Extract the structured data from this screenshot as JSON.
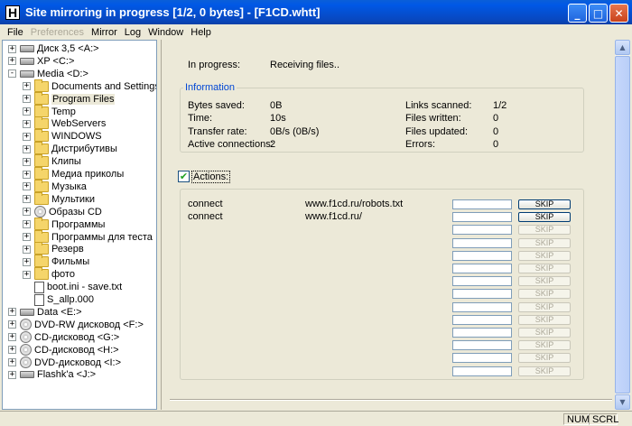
{
  "window": {
    "title": "Site mirroring in progress [1/2, 0 bytes] - [F1CD.whtt]",
    "icon_letter": "H",
    "buttons": [
      "minimize-icon",
      "maximize-icon",
      "close-icon"
    ]
  },
  "menu": [
    "File",
    "Preferences",
    "Mirror",
    "Log",
    "Window",
    "Help"
  ],
  "tree": [
    {
      "label": "Диск 3,5 <A:>",
      "icon": "floppy-drive-icon",
      "expander": "+",
      "level": 0
    },
    {
      "label": "XP <C:>",
      "icon": "hard-drive-icon",
      "expander": "+",
      "level": 0
    },
    {
      "label": "Media <D:>",
      "icon": "hard-drive-icon",
      "expander": "-",
      "level": 0
    },
    {
      "label": "Documents and Settings",
      "icon": "folder-icon",
      "expander": "+",
      "level": 1
    },
    {
      "label": "Program Files",
      "icon": "folder-icon",
      "expander": "+",
      "level": 1,
      "selected": true
    },
    {
      "label": "Temp",
      "icon": "folder-icon",
      "expander": "+",
      "level": 1
    },
    {
      "label": "WebServers",
      "icon": "folder-icon",
      "expander": "+",
      "level": 1
    },
    {
      "label": "WINDOWS",
      "icon": "folder-icon",
      "expander": "+",
      "level": 1
    },
    {
      "label": "Дистрибутивы",
      "icon": "folder-icon",
      "expander": "+",
      "level": 1
    },
    {
      "label": "Клипы",
      "icon": "folder-icon",
      "expander": "+",
      "level": 1
    },
    {
      "label": "Медиа приколы",
      "icon": "folder-icon",
      "expander": "+",
      "level": 1
    },
    {
      "label": "Музыка",
      "icon": "music-folder-icon",
      "expander": "+",
      "level": 1
    },
    {
      "label": "Мультики",
      "icon": "folder-icon",
      "expander": "+",
      "level": 1
    },
    {
      "label": "Образы CD",
      "icon": "cd-folder-icon",
      "expander": "+",
      "level": 1
    },
    {
      "label": "Программы",
      "icon": "folder-icon",
      "expander": "+",
      "level": 1
    },
    {
      "label": "Программы для теста",
      "icon": "folder-icon",
      "expander": "+",
      "level": 1
    },
    {
      "label": "Резерв",
      "icon": "folder-icon",
      "expander": "+",
      "level": 1
    },
    {
      "label": "Фильмы",
      "icon": "folder-icon",
      "expander": "+",
      "level": 1
    },
    {
      "label": "фото",
      "icon": "folder-icon",
      "expander": "+",
      "level": 1
    },
    {
      "label": "boot.ini - save.txt",
      "icon": "text-file-icon",
      "expander": "",
      "level": 1
    },
    {
      "label": "S_allp.000",
      "icon": "file-icon",
      "expander": "",
      "level": 1
    },
    {
      "label": "Data <E:>",
      "icon": "hard-drive-icon",
      "expander": "+",
      "level": 0
    },
    {
      "label": "DVD-RW дисковод <F:>",
      "icon": "cd-drive-icon",
      "expander": "+",
      "level": 0
    },
    {
      "label": "CD-дисковод <G:>",
      "icon": "cd-drive-icon",
      "expander": "+",
      "level": 0
    },
    {
      "label": "CD-дисковод <H:>",
      "icon": "cd-drive-icon",
      "expander": "+",
      "level": 0
    },
    {
      "label": "DVD-дисковод <I:>",
      "icon": "cd-drive-icon",
      "expander": "+",
      "level": 0
    },
    {
      "label": "Flashk'a <J:>",
      "icon": "usb-drive-icon",
      "expander": "+",
      "level": 0
    }
  ],
  "progress": {
    "status_label": "In progress:",
    "status_value": "Receiving files.."
  },
  "info": {
    "title": "Information",
    "bytes_saved_label": "Bytes saved:",
    "bytes_saved": "0B",
    "time_label": "Time:",
    "time": "10s",
    "transfer_rate_label": "Transfer rate:",
    "transfer_rate": "0B/s (0B/s)",
    "active_connections_label": "Active connections:",
    "active_connections": "2",
    "links_scanned_label": "Links scanned:",
    "links_scanned": "1/2",
    "files_written_label": "Files written:",
    "files_written": "0",
    "files_updated_label": "Files updated:",
    "files_updated": "0",
    "errors_label": "Errors:",
    "errors": "0"
  },
  "actions": {
    "checkbox_label": "Actions:",
    "checked": true,
    "rows": [
      {
        "action": "connect",
        "url": "www.f1cd.ru/robots.txt",
        "skip": "SKIP",
        "enabled": true
      },
      {
        "action": "connect",
        "url": "www.f1cd.ru/",
        "skip": "SKIP",
        "enabled": true
      },
      {
        "action": "",
        "url": "",
        "skip": "SKIP",
        "enabled": false
      },
      {
        "action": "",
        "url": "",
        "skip": "SKIP",
        "enabled": false
      },
      {
        "action": "",
        "url": "",
        "skip": "SKIP",
        "enabled": false
      },
      {
        "action": "",
        "url": "",
        "skip": "SKIP",
        "enabled": false
      },
      {
        "action": "",
        "url": "",
        "skip": "SKIP",
        "enabled": false
      },
      {
        "action": "",
        "url": "",
        "skip": "SKIP",
        "enabled": false
      },
      {
        "action": "",
        "url": "",
        "skip": "SKIP",
        "enabled": false
      },
      {
        "action": "",
        "url": "",
        "skip": "SKIP",
        "enabled": false
      },
      {
        "action": "",
        "url": "",
        "skip": "SKIP",
        "enabled": false
      },
      {
        "action": "",
        "url": "",
        "skip": "SKIP",
        "enabled": false
      },
      {
        "action": "",
        "url": "",
        "skip": "SKIP",
        "enabled": false
      },
      {
        "action": "",
        "url": "",
        "skip": "SKIP",
        "enabled": false
      }
    ]
  },
  "status_bar": [
    "NUM",
    "SCRL"
  ],
  "colors": {
    "titlebar": "#0058e6",
    "group_title": "#0046d5",
    "face": "#ece9d8"
  }
}
